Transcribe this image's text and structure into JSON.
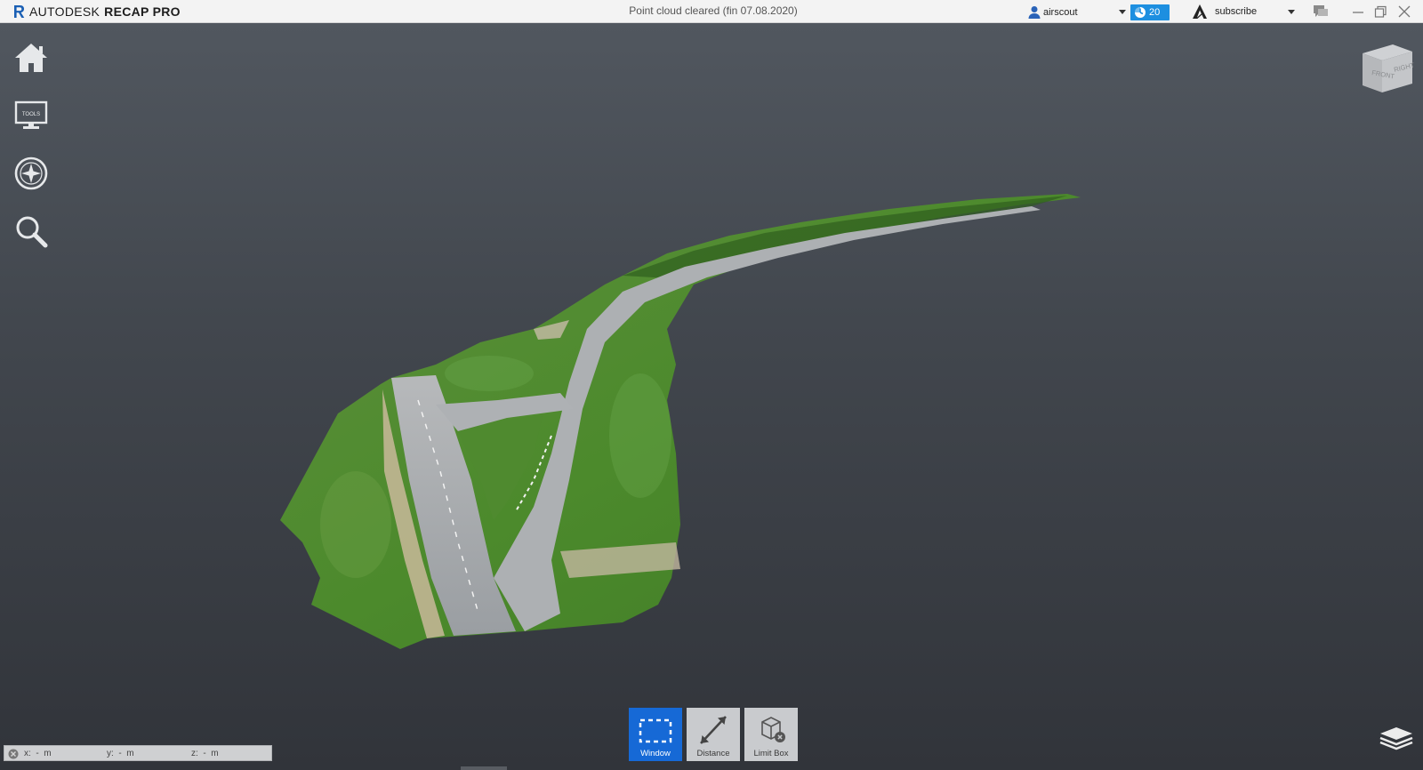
{
  "app": {
    "company": "AUTODESK",
    "product": "RECAP PRO",
    "document_title": "Point cloud cleared (fin 07.08.2020)"
  },
  "header": {
    "user_name": "airscout",
    "trial_days": "20",
    "subscribe_label": "subscribe",
    "accent_color": "#1d8fe0"
  },
  "left_toolbar": {
    "items": [
      {
        "icon": "home-icon"
      },
      {
        "icon": "display-tools-icon",
        "caption": "TOOLS"
      },
      {
        "icon": "navigation-compass-icon"
      },
      {
        "icon": "search-icon"
      }
    ]
  },
  "viewcube": {
    "front_label": "FRONT",
    "right_label": "RIGHT"
  },
  "bottom_toolbar": {
    "tools": [
      {
        "label": "Window",
        "icon": "window-select-icon",
        "active": true
      },
      {
        "label": "Distance",
        "icon": "distance-measure-icon",
        "active": false
      },
      {
        "label": "Limit Box",
        "icon": "limit-box-icon",
        "active": false
      }
    ],
    "active_color": "#1669d6"
  },
  "status": {
    "x": "x:  -  m",
    "y": "y:  -  m",
    "z": "z:  -  m"
  }
}
